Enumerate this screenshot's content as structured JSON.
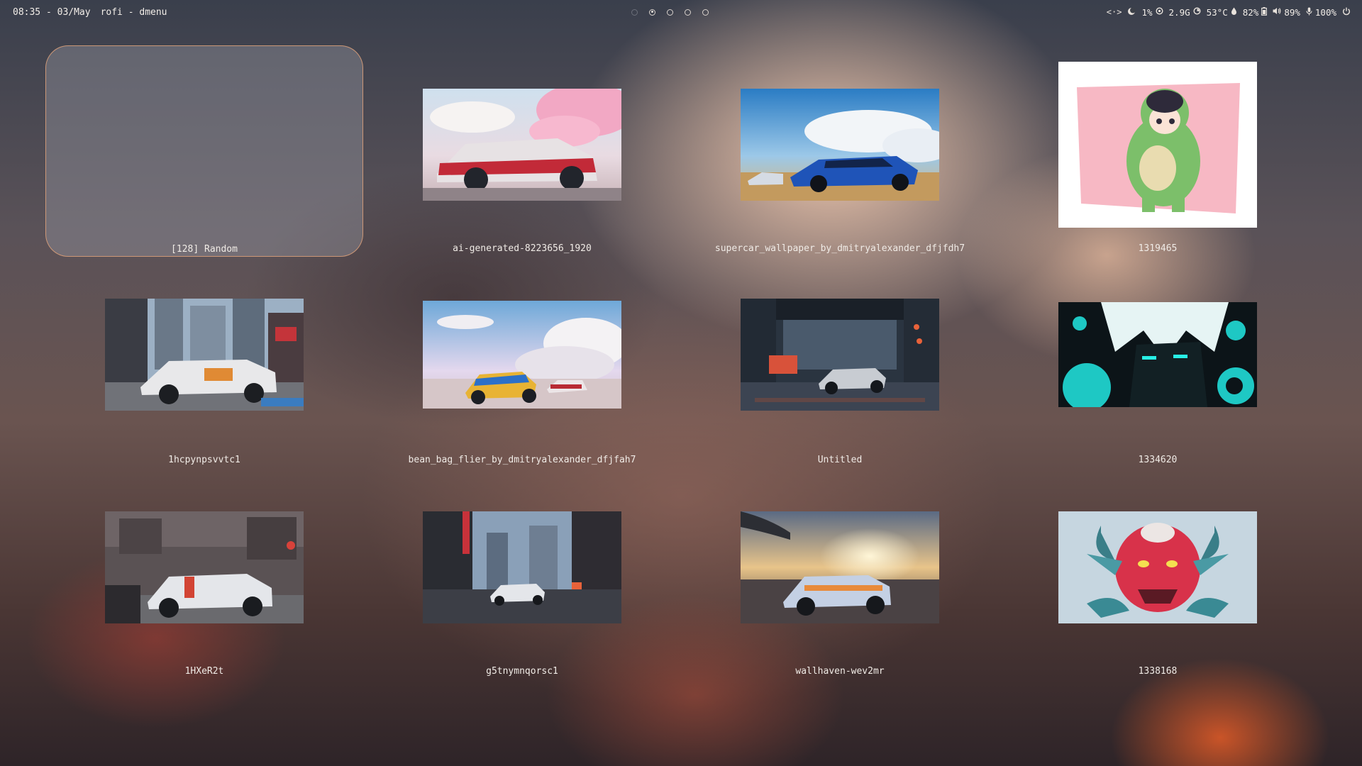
{
  "topbar": {
    "datetime": "08:35 - 03/May",
    "window_title": "rofi - dmenu",
    "workspaces": [
      {
        "state": "dim"
      },
      {
        "state": "active"
      },
      {
        "state": "idle"
      },
      {
        "state": "idle"
      },
      {
        "state": "idle"
      }
    ],
    "status": {
      "network_icon": "<·>",
      "cpu": "1%",
      "memory": "2.9G",
      "temperature": "53°C",
      "battery": "82%",
      "volume": "89%",
      "mic": "100%"
    },
    "icons": [
      "network-icon",
      "moon-icon",
      "cpu-icon",
      "memory-icon",
      "temperature-icon",
      "battery-icon",
      "volume-icon",
      "microphone-icon",
      "power-icon"
    ]
  },
  "menu": {
    "entries": [
      {
        "label": "[128] Random",
        "selected": true
      },
      {
        "label": "ai-generated-8223656_1920"
      },
      {
        "label": "supercar_wallpaper_by_dmitryalexander_dfjfdh7"
      },
      {
        "label": "1319465"
      },
      {
        "label": "1hcpynpsvvtc1"
      },
      {
        "label": "bean_bag_flier_by_dmitryalexander_dfjfah7"
      },
      {
        "label": "Untitled"
      },
      {
        "label": "1334620"
      },
      {
        "label": "1HXeR2t"
      },
      {
        "label": "g5tnymnqorsc1"
      },
      {
        "label": "wallhaven-wev2mr"
      },
      {
        "label": "1338168"
      }
    ]
  },
  "colors": {
    "selection_border": "#dea078",
    "text": "#f0ebe6"
  }
}
